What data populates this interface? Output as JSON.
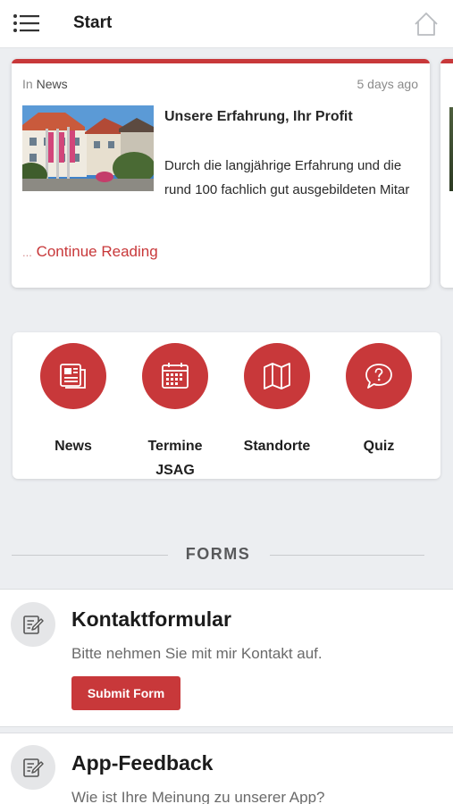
{
  "header": {
    "title": "Start",
    "menu_icon": "list-menu-icon",
    "home_icon": "home-icon"
  },
  "news_card": {
    "category_prefix": "In",
    "category": "News",
    "time": "5 days ago",
    "headline": "Unsere Erfahrung, Ihr Profit",
    "excerpt": "Durch die langjährige Erfahrung und die rund 100 fachlich gut ausgebildeten Mitar",
    "more_dots": "...",
    "more_label": "Continue Reading"
  },
  "quick_links": [
    {
      "label": "News",
      "icon": "newspaper-icon"
    },
    {
      "label": "Termine JSAG",
      "icon": "calendar-icon"
    },
    {
      "label": "Standorte",
      "icon": "map-icon"
    },
    {
      "label": "Quiz",
      "icon": "question-bubble-icon"
    }
  ],
  "forms_section": {
    "title": "FORMS",
    "items": [
      {
        "title": "Kontaktformular",
        "description": "Bitte nehmen Sie mit mir Kontakt auf.",
        "button": "Submit Form",
        "icon": "edit-form-icon"
      },
      {
        "title": "App-Feedback",
        "description": "Wie ist Ihre Meinung zu unserer App?",
        "icon": "edit-form-icon"
      }
    ]
  },
  "colors": {
    "accent": "#c8383a",
    "background": "#eceef1",
    "card": "#ffffff"
  }
}
